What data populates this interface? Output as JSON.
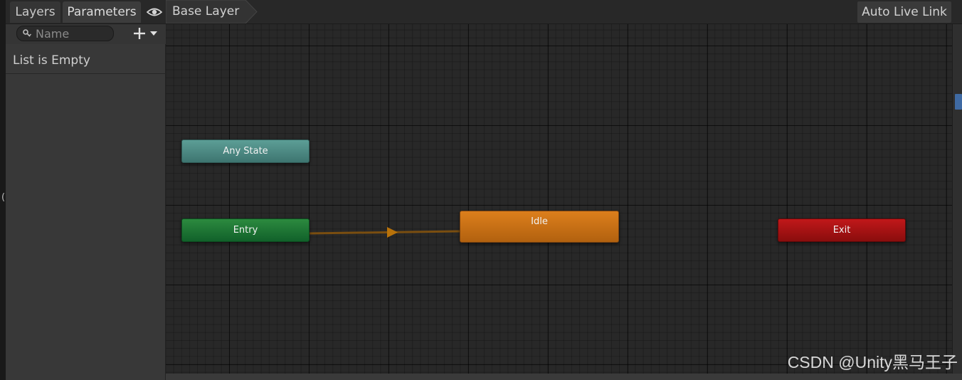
{
  "sidebar": {
    "tabs": [
      {
        "label": "Layers"
      },
      {
        "label": "Parameters"
      }
    ],
    "search": {
      "placeholder": "Name",
      "value": ""
    },
    "empty_text": "List is Empty"
  },
  "header": {
    "breadcrumb": "Base Layer",
    "auto_live_link": "Auto Live Link"
  },
  "graph": {
    "states": {
      "any_state": "Any State",
      "entry": "Entry",
      "idle": "Idle",
      "exit": "Exit"
    },
    "colors": {
      "any_state": "#4f8c86",
      "entry": "#1a7532",
      "idle": "#c86f14",
      "exit": "#a81212",
      "transition": "#7a4e10"
    }
  },
  "watermark": "CSDN @Unity黑马王子"
}
